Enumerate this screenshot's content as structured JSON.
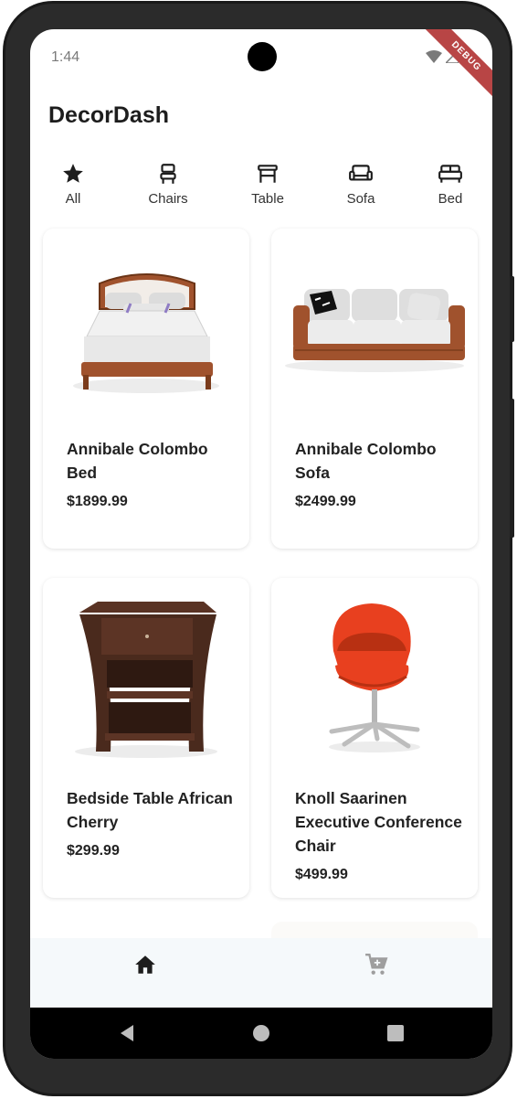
{
  "status": {
    "time": "1:44",
    "debug_label": "DEBUG"
  },
  "app": {
    "title": "DecorDash"
  },
  "categories": [
    {
      "label": "All",
      "icon": "star-icon"
    },
    {
      "label": "Chairs",
      "icon": "chair-icon"
    },
    {
      "label": "Table",
      "icon": "table-icon"
    },
    {
      "label": "Sofa",
      "icon": "sofa-icon"
    },
    {
      "label": "Bed",
      "icon": "bed-icon"
    }
  ],
  "products": [
    {
      "name": "Annibale Colombo Bed",
      "price": "$1899.99",
      "image": "bed-image"
    },
    {
      "name": "Annibale Colombo Sofa",
      "price": "$2499.99",
      "image": "sofa-image"
    },
    {
      "name": "Bedside Table African Cherry",
      "price": "$299.99",
      "image": "bedside-table-image"
    },
    {
      "name": "Knoll Saarinen Executive Conference Chair",
      "price": "$499.99",
      "image": "office-chair-image"
    }
  ],
  "bottom_nav": [
    {
      "icon": "home-icon",
      "active": true
    },
    {
      "icon": "cart-icon",
      "active": false
    }
  ],
  "colors": {
    "active_icon": "#1d1d1d",
    "inactive_icon": "#9e9e9e",
    "debug_banner": "#b84545",
    "chair_red": "#e8401f",
    "wood_brown": "#a0522d"
  }
}
